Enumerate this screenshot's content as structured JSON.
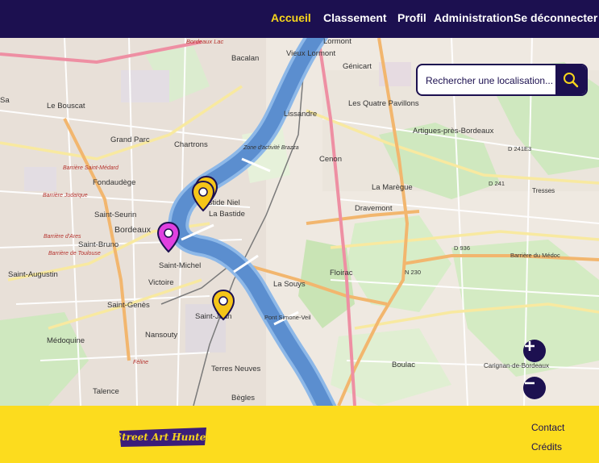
{
  "nav": {
    "items": [
      {
        "label": "Accueil",
        "active": true
      },
      {
        "label": "Classement",
        "active": false
      },
      {
        "label": "Profil",
        "active": false
      },
      {
        "label": "Administration",
        "active": false
      },
      {
        "label": "Se déconnecter",
        "active": false
      }
    ]
  },
  "search": {
    "placeholder": "Rechercher une localisation...",
    "icon": "search-icon"
  },
  "map": {
    "labels": [
      "Bordeaux Lac",
      "Lormont",
      "Bacalan",
      "Vieux Lormont",
      "Génicart",
      "Le Bouscat",
      "Lissandre",
      "Les Quatre Pavillons",
      "Artigues-près-Bordeaux",
      "Grand Parc",
      "Chartrons",
      "Zone d'activité Brazza",
      "Cenon",
      "Fondaudège",
      "Bastide Niel",
      "La Bastide",
      "La Marègue",
      "Dravemont",
      "Saint-Seurin",
      "Bordeaux",
      "Saint-Bruno",
      "Saint-Michel",
      "Floirac",
      "Saint-Augustin",
      "Victoire",
      "La Souys",
      "Saint-Genès",
      "Saint-Jean",
      "Pont Simone-Veil",
      "Nansouty",
      "Médoquine",
      "Boulac",
      "Carignan-de-Bordeaux",
      "Terres Neuves",
      "Talence",
      "Bègles",
      "Tresses",
      "D 241E3",
      "D 241",
      "D 936",
      "N 230",
      "Barrière du Médoc",
      "Barrière Saint-Médard",
      "Barrière Judaïque",
      "Barrière d'Ares",
      "Barrière de Toulouse",
      "Féline",
      "Sa"
    ],
    "markers": [
      {
        "name": "marker-chartrons",
        "color": "#f5c518"
      },
      {
        "name": "marker-bastide",
        "color": "#f5c518"
      },
      {
        "name": "marker-bordeaux",
        "color": "#e040e0"
      },
      {
        "name": "marker-saint-jean",
        "color": "#f5c518"
      }
    ],
    "zoom_in_icon": "plus-icon",
    "zoom_out_icon": "minus-icon"
  },
  "footer": {
    "logo_text": "Street Art Hunter",
    "links": [
      "Contact",
      "Crédits"
    ]
  },
  "colors": {
    "brand_dark": "#1c1050",
    "brand_yellow": "#fcdc1e",
    "active_nav": "#f7d51c",
    "river": "#5b8ecf"
  }
}
